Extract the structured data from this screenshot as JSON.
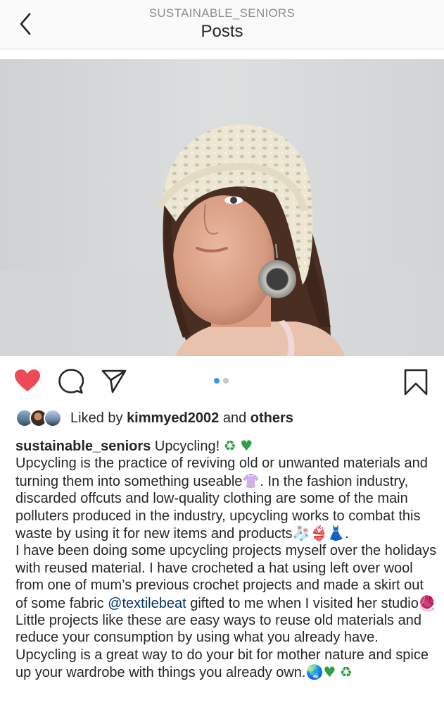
{
  "header": {
    "account": "SUSTAINABLE_SENIORS",
    "title": "Posts"
  },
  "actions": {
    "liked": true,
    "carousel_index": 1,
    "carousel_count": 2,
    "icons": [
      "heart-icon",
      "comment-icon",
      "share-icon",
      "bookmark-icon"
    ],
    "like_color": "#ed4956",
    "dot_active_color": "#3897f0"
  },
  "likes": {
    "prefix": "Liked by ",
    "user": "kimmyed2002",
    "middle": " and ",
    "others": "others"
  },
  "caption": {
    "username": "sustainable_seniors",
    "heading": " Upcycling! ",
    "emoji_recycle": "♻",
    "emoji_heart": "♥",
    "emoji_shirt": "👚",
    "emoji_sock": "🧦",
    "emoji_bikini": "👙",
    "emoji_dress": "👗",
    "emoji_yarn": "🧶",
    "emoji_earth": "🌏",
    "p1_a": "Upcycling is the practice of reviving old or unwanted materials and turning them into something useable",
    "p1_b": ". In the fashion industry, discarded offcuts and low-quality clothing are some of the main polluters produced in the industry, upcycling works to combat this waste by using it for new items and products",
    "p1_c": ".",
    "p2_a": "I have been doing some upcycling projects myself over the holidays with reused material. I have crocheted a hat using left over wool from one of mum’s previous crochet projects and made a skirt out of some fabric ",
    "mention": "@textilebeat",
    "p2_b": " gifted to me when I visited her studio",
    "p2_c": "Little projects like these are easy ways to reuse old materials and reduce your consumption by using what you already have. Upcycling is a great way to do your bit for mother nature and spice up your wardrobe with things you already own."
  }
}
